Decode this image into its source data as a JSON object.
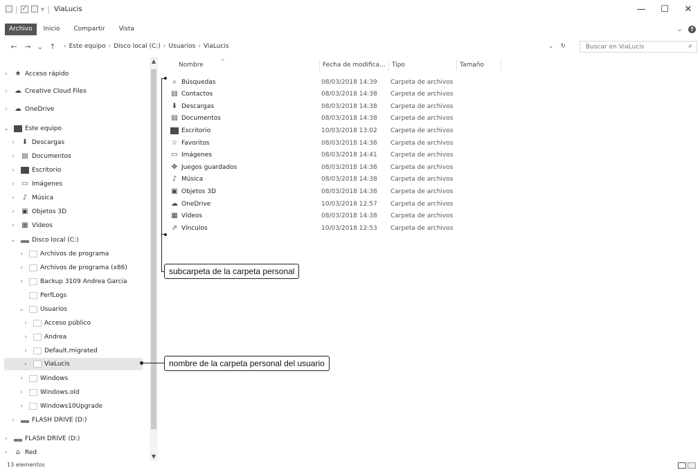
{
  "window": {
    "title": "ViaLucis",
    "minimize": "—",
    "maximize": "☐",
    "close": "✕"
  },
  "ribbon": {
    "tabs": [
      "Archivo",
      "Inicio",
      "Compartir",
      "Vista"
    ]
  },
  "address": {
    "crumbs": [
      "Este equipo",
      "Disco local (C:)",
      "Usuarios",
      "ViaLucis"
    ],
    "search_placeholder": "Buscar en ViaLucis"
  },
  "nav": {
    "items": [
      {
        "label": "Acceso rápido",
        "icon": "star-icon"
      },
      {
        "label": "Creative Cloud Files",
        "icon": "cloud-icon"
      },
      {
        "label": "OneDrive",
        "icon": "onedrive-icon"
      },
      {
        "label": "Este equipo",
        "icon": "computer-icon"
      },
      {
        "label": "Descargas",
        "icon": "download-icon"
      },
      {
        "label": "Documentos",
        "icon": "document-icon"
      },
      {
        "label": "Escritorio",
        "icon": "desktop-icon"
      },
      {
        "label": "Imágenes",
        "icon": "image-icon"
      },
      {
        "label": "Música",
        "icon": "music-icon"
      },
      {
        "label": "Objetos 3D",
        "icon": "cube-icon"
      },
      {
        "label": "Vídeos",
        "icon": "video-icon"
      },
      {
        "label": "Disco local (C:)",
        "icon": "drive-icon"
      },
      {
        "label": "Archivos de programa",
        "icon": "folder-icon"
      },
      {
        "label": "Archivos de programa (x86)",
        "icon": "folder-icon"
      },
      {
        "label": "Backup 3109 Andrea Garcia",
        "icon": "folder-icon"
      },
      {
        "label": "PerfLogs",
        "icon": "folder-icon"
      },
      {
        "label": "Usuarios",
        "icon": "folder-icon"
      },
      {
        "label": "Acceso público",
        "icon": "folder-icon"
      },
      {
        "label": "Andrea",
        "icon": "folder-icon"
      },
      {
        "label": "Default.migrated",
        "icon": "folder-icon"
      },
      {
        "label": "ViaLucis",
        "icon": "folder-icon"
      },
      {
        "label": "Windows",
        "icon": "folder-icon"
      },
      {
        "label": "Windows.old",
        "icon": "folder-icon"
      },
      {
        "label": "Windows10Upgrade",
        "icon": "folder-icon"
      },
      {
        "label": "FLASH DRIVE (D:)",
        "icon": "usb-drive-icon"
      },
      {
        "label": "FLASH DRIVE (D:)",
        "icon": "usb-drive-icon"
      },
      {
        "label": "Red",
        "icon": "network-icon"
      }
    ]
  },
  "columns": {
    "name": "Nombre",
    "date": "Fecha de modifica...",
    "type": "Tipo",
    "size": "Tamaño"
  },
  "files": [
    {
      "name": "Búsquedas",
      "date": "08/03/2018 14:39",
      "type": "Carpeta de archivos",
      "icon": "search-icon"
    },
    {
      "name": "Contactos",
      "date": "08/03/2018 14:38",
      "type": "Carpeta de archivos",
      "icon": "contacts-icon"
    },
    {
      "name": "Descargas",
      "date": "08/03/2018 14:38",
      "type": "Carpeta de archivos",
      "icon": "download-icon"
    },
    {
      "name": "Documentos",
      "date": "08/03/2018 14:38",
      "type": "Carpeta de archivos",
      "icon": "document-icon"
    },
    {
      "name": "Escritorio",
      "date": "10/03/2018 13:02",
      "type": "Carpeta de archivos",
      "icon": "desktop-icon"
    },
    {
      "name": "Favoritos",
      "date": "08/03/2018 14:38",
      "type": "Carpeta de archivos",
      "icon": "star-icon"
    },
    {
      "name": "Imágenes",
      "date": "08/03/2018 14:41",
      "type": "Carpeta de archivos",
      "icon": "image-icon"
    },
    {
      "name": "Juegos guardados",
      "date": "08/03/2018 14:38",
      "type": "Carpeta de archivos",
      "icon": "games-icon"
    },
    {
      "name": "Música",
      "date": "08/03/2018 14:38",
      "type": "Carpeta de archivos",
      "icon": "music-icon"
    },
    {
      "name": "Objetos 3D",
      "date": "08/03/2018 14:38",
      "type": "Carpeta de archivos",
      "icon": "cube-icon"
    },
    {
      "name": "OneDrive",
      "date": "10/03/2018 12:57",
      "type": "Carpeta de archivos",
      "icon": "onedrive-icon"
    },
    {
      "name": "Vídeos",
      "date": "08/03/2018 14:38",
      "type": "Carpeta de archivos",
      "icon": "video-icon"
    },
    {
      "name": "Vínculos",
      "date": "10/03/2018 12:53",
      "type": "Carpeta de archivos",
      "icon": "link-icon"
    }
  ],
  "annotations": {
    "subfolders": "subcarpeta de la carpeta personal",
    "user_folder": "nombre de la carpeta personal del usuario"
  },
  "status": {
    "count": "13 elementos"
  }
}
